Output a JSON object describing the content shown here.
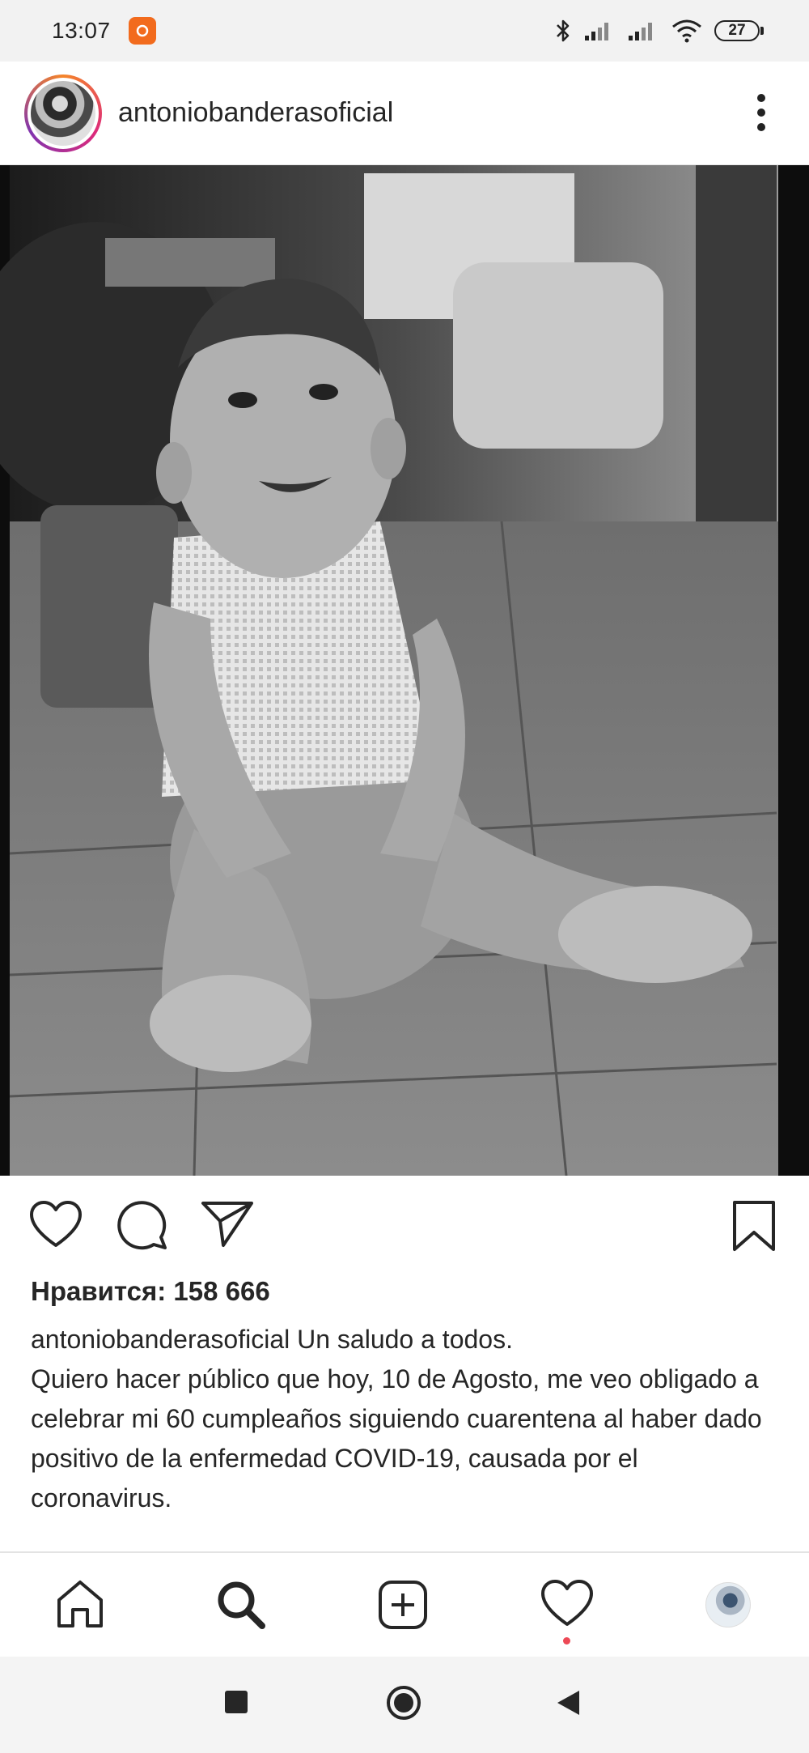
{
  "status_bar": {
    "time": "13:07",
    "battery": "27",
    "icons": [
      "notification-app-icon",
      "bluetooth-icon",
      "signal-icon",
      "signal-icon",
      "wifi-icon",
      "battery-icon"
    ]
  },
  "post": {
    "username": "antoniobanderasoficial",
    "likes_text": "Нравится: 158 666",
    "caption_username": "antoniobanderasoficial",
    "caption_text": "Un saludo a todos.\nQuiero hacer público que hoy, 10 de Agosto, me veo obligado a celebrar mi 60 cumpleaños siguiendo cuarentena al haber dado positivo de la enfermedad COVID-19, causada por el coronavirus."
  },
  "actions": [
    "like-icon",
    "comment-icon",
    "share-icon",
    "save-icon"
  ],
  "bottom_nav": [
    "home-icon",
    "search-icon",
    "new-post-icon",
    "activity-icon",
    "profile-avatar"
  ],
  "system_nav": [
    "recents-button",
    "home-button",
    "back-button"
  ],
  "colors": {
    "notification_dot": "#ed4956",
    "story_ring": "#dd2a7b"
  }
}
